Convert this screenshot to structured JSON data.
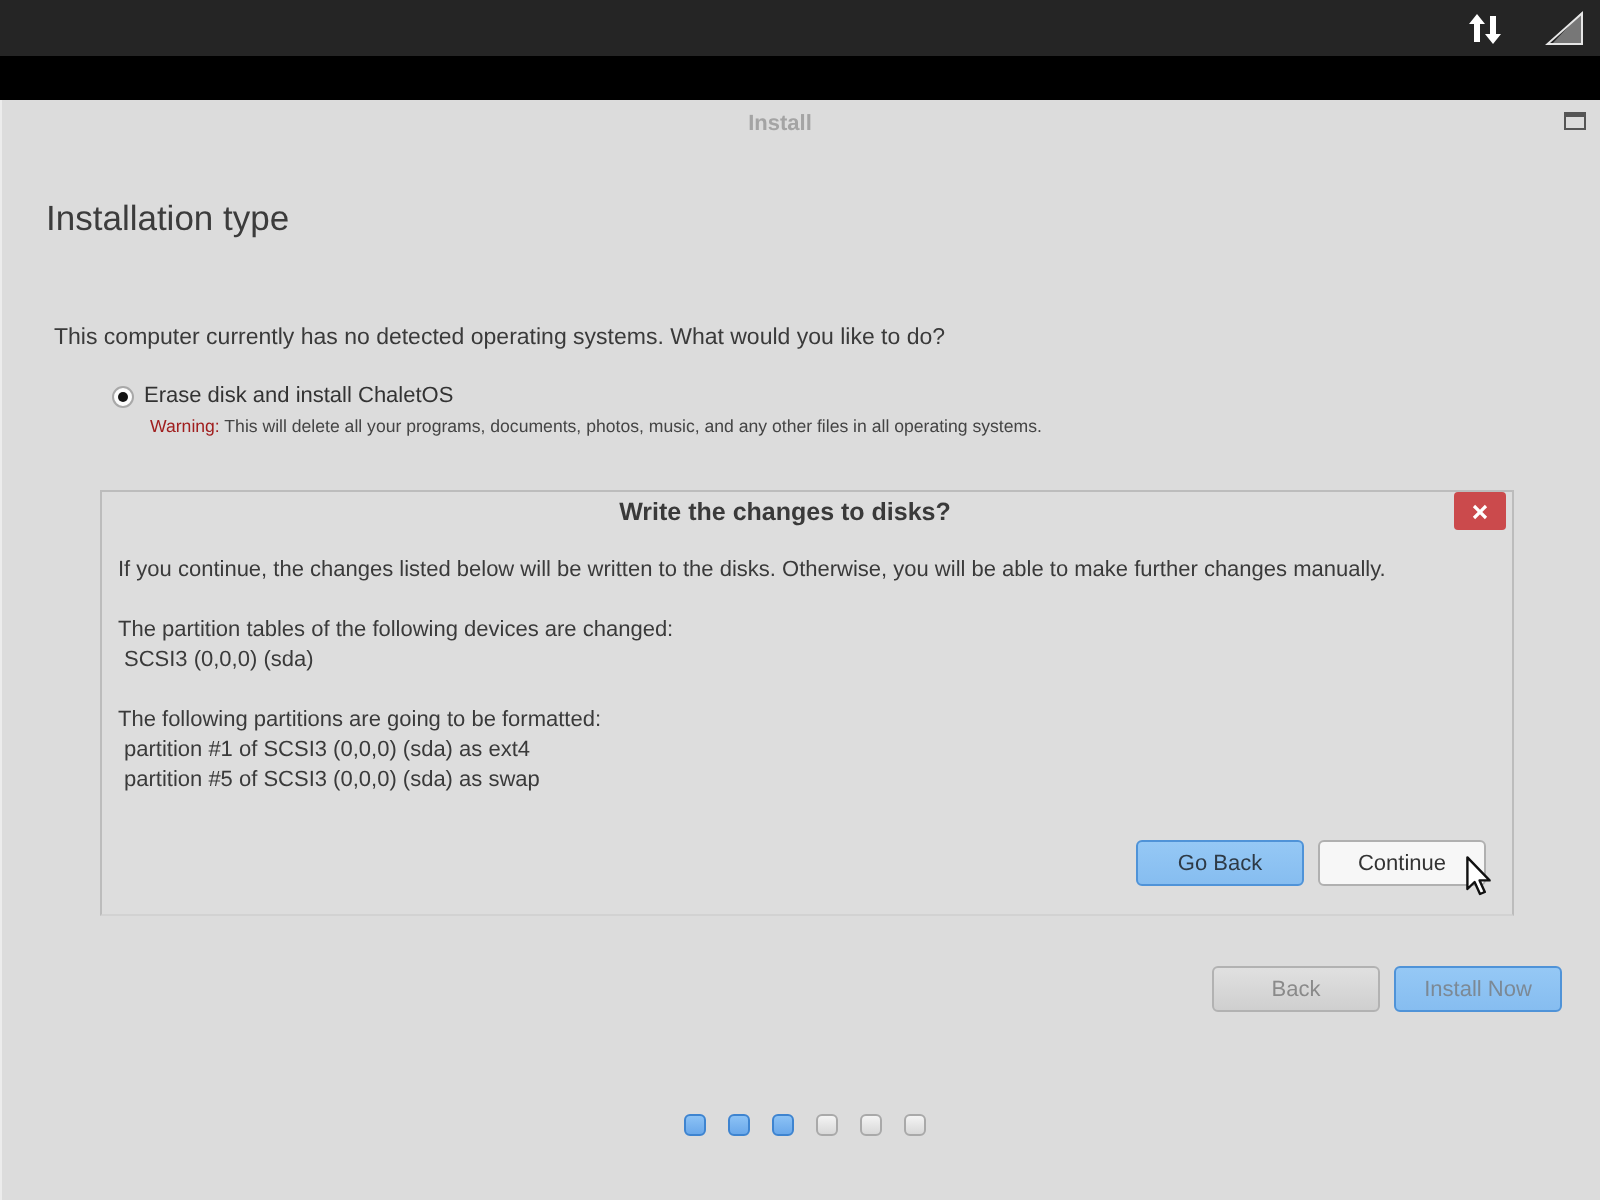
{
  "window": {
    "title": "Install"
  },
  "page": {
    "heading": "Installation type",
    "question": "This computer currently has no detected operating systems. What would you like to do?",
    "options": [
      {
        "label": "Erase disk and install ChaletOS",
        "selected": true,
        "warning": {
          "label": "Warning:",
          "text": "This will delete all your programs, documents, photos, music, and any other files in all operating systems."
        }
      }
    ]
  },
  "dialog": {
    "title": "Write the changes to disks?",
    "intro": "If you continue, the changes listed below will be written to the disks. Otherwise, you will be able to make further changes manually.",
    "sections": [
      {
        "heading": "The partition tables of the following devices are changed:",
        "items": [
          "SCSI3 (0,0,0) (sda)"
        ]
      },
      {
        "heading": "The following partitions are going to be formatted:",
        "items": [
          "partition #1 of SCSI3 (0,0,0) (sda) as ext4",
          "partition #5 of SCSI3 (0,0,0) (sda) as swap"
        ]
      }
    ],
    "buttons": [
      {
        "label": "Go Back",
        "kind": "primary"
      },
      {
        "label": "Continue",
        "kind": "default"
      }
    ]
  },
  "buttons": [
    {
      "label": "Back",
      "kind": "default",
      "disabled": true
    },
    {
      "label": "Install Now",
      "kind": "primary",
      "disabled": true
    }
  ],
  "steps": [
    {
      "completed": true
    },
    {
      "completed": true
    },
    {
      "completed": true
    },
    {
      "completed": false
    },
    {
      "completed": false
    },
    {
      "completed": false
    }
  ]
}
